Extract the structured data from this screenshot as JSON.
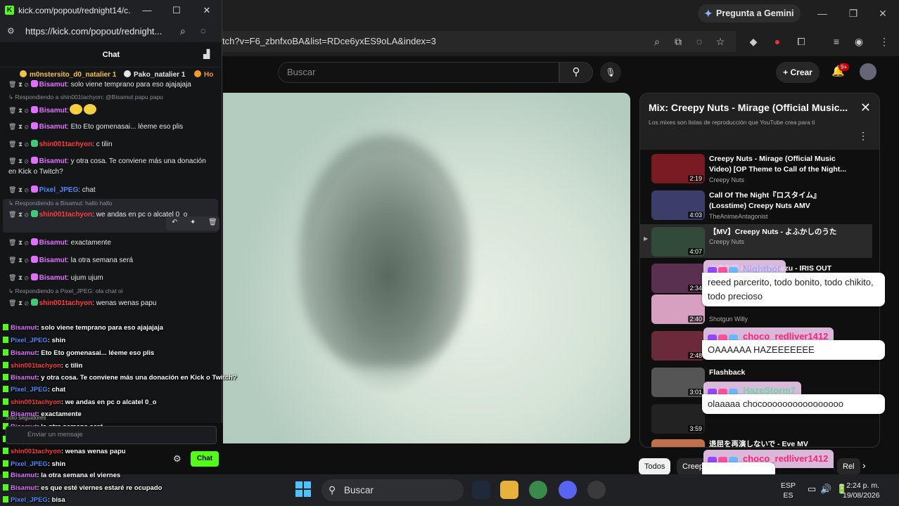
{
  "browser": {
    "gemini_label": "Pregunta a Gemini",
    "url": "tch?v=F6_zbnfxoBA&list=RDce6yxES9oLA&index=3"
  },
  "youtube": {
    "search_placeholder": "Buscar",
    "create_label": "Crear",
    "notif_badge": "9+",
    "playlist": {
      "title": "Mix: Creepy Nuts - Mirage (Official Music...",
      "subtitle": "Los mixes son listas de reproducción que YouTube crea para ti",
      "items": [
        {
          "title": "Creepy Nuts - Mirage (Official Music Video) [OP Theme to Call of the Night...",
          "channel": "Creepy Nuts",
          "duration": "2:19",
          "color": "#7a1a22"
        },
        {
          "title": "Call Of The Night『ロスタイム』(Losstime) Creepy Nuts AMV",
          "channel": "TheAnimeAntagonist",
          "duration": "4:03",
          "color": "#3c3d6b"
        },
        {
          "title": "【MV】Creepy Nuts - よふかしのうた",
          "channel": "Creepy Nuts",
          "duration": "4:07",
          "color": "#314a3a"
        },
        {
          "title": "米津玄師 Kenshi Yonezu - IRIS OUT",
          "channel": "",
          "duration": "2:34",
          "color": "#5a3050"
        },
        {
          "title": "",
          "channel": "Shotgun Willy",
          "duration": "2:40",
          "color": "#d8a0c0"
        },
        {
          "title": "",
          "channel": "",
          "duration": "2:48",
          "color": "#6a2a3a"
        },
        {
          "title": "Flashback",
          "channel": "",
          "duration": "3:01",
          "color": "#555"
        },
        {
          "title": "",
          "channel": "",
          "duration": "3:59",
          "color": "#222"
        },
        {
          "title": "退屈を再演しないで - Eve MV",
          "channel": "",
          "duration": "",
          "color": "#c0704a"
        }
      ]
    },
    "chips": [
      "Todos",
      "Creep",
      "Rel"
    ]
  },
  "overlay_right": [
    {
      "name": "Nightbot",
      "name_color": "#a5a7f5",
      "message": "reeed parcerito, todo bonito, todo chikito, todo precioso"
    },
    {
      "name": "choco_redliver1412",
      "name_color": "#ff2277",
      "message": "OAAAAAA HAZEEEEEEE"
    },
    {
      "name": "HazeStorm7",
      "name_color": "#67d7a4",
      "message": "olaaaaa chocoooooooooooooooo"
    },
    {
      "name": "choco_redliver1412",
      "name_color": "#ff2277",
      "message": ""
    }
  ],
  "taskbar": {
    "search": "Buscar",
    "lang_top": "ESP",
    "lang_bottom": "ES",
    "time": "2:24 p. m.",
    "date": "19/08/2026"
  },
  "kick": {
    "window_title": "kick.com/popout/rednight14/c...",
    "url": "https://kick.com/popout/rednight...",
    "chat_title": "Chat",
    "pinned": [
      {
        "name": "m0nstersito_d0_natalier",
        "count": "1",
        "color": "#f6c244"
      },
      {
        "name": "Pako_natalier",
        "count": "1",
        "color": "#e6e6e6"
      },
      {
        "name": "Ho",
        "count": "",
        "color": "#f39a2e"
      }
    ],
    "messages": [
      {
        "user": "Bisamut",
        "text": ": solo viene temprano para eso ajajajaja"
      },
      {
        "reply": "Respondiendo a shin001tachyon: @Bisamut papu papu"
      },
      {
        "user": "Bisamut",
        "text": ":"
      },
      {
        "user": "Bisamut",
        "text": ": Eto Eto gomenasai... léeme eso plis"
      },
      {
        "user": "shin001tachyon",
        "text": ": c tilin"
      },
      {
        "user": "Bisamut",
        "text": ": y otra cosa. Te conviene más una donación en Kick o Twitch?"
      },
      {
        "user": "Pixel_JPEG",
        "text": ": chat"
      },
      {
        "reply": "Respondiendo a Bisamut: hallo hallo"
      },
      {
        "user": "shin001tachyon",
        "text": ": we andas en pc o alcatel 0_o"
      },
      {
        "user": "Bisamut",
        "text": ": exactamente"
      },
      {
        "user": "Bisamut",
        "text": ": la otra semana será"
      },
      {
        "user": "Bisamut",
        "text": ": ujum ujum"
      },
      {
        "reply": "Respondiendo a Pixel_JPEG: ola chat oi"
      },
      {
        "user": "shin001tachyon",
        "text": ": wenas wenas papu"
      }
    ],
    "overlay": [
      {
        "user": "Bisamut",
        "text": ": solo viene temprano para eso ajajajaja"
      },
      {
        "user": "Pixel_JPEG",
        "text": ": shin"
      },
      {
        "user": "Bisamut",
        "text": ": Eto Eto gomenasai... léeme eso plis"
      },
      {
        "user": "shin001tachyon",
        "text": ": c tilin"
      },
      {
        "user": "Bisamut",
        "text": ": y otra cosa. Te conviene más una donación en Kick o Twitch?"
      },
      {
        "user": "Pixel_JPEG",
        "text": ": chat"
      },
      {
        "user": "shin001tachyon",
        "text": ": we andas en pc o alcatel 0_o"
      },
      {
        "user": "Bisamut",
        "text": ": exactamente"
      },
      {
        "user": "Bisamut",
        "text": ": la otra semana será"
      },
      {
        "user": "Bisamut",
        "text": ": ujum ujum"
      },
      {
        "user": "shin001tachyon",
        "text": ": wenas wenas papu"
      },
      {
        "user": "Pixel_JPEG",
        "text": ": shin"
      },
      {
        "user": "Bisamut",
        "text": ": la otra semana el viernes"
      },
      {
        "user": "Bisamut",
        "text": ": es que esté viernes estaré re ocupado"
      },
      {
        "user": "Pixel_JPEG",
        "text": ": bisa"
      }
    ],
    "followers_only": "Solo seguidores",
    "input_placeholder": "Enviar un mensaje",
    "chat_button": "Chat",
    "colors": {
      "Bisamut": "#e070ff",
      "shin001tachyon": "#ff3a3a",
      "Pixel_JPEG": "#4d8bff"
    }
  }
}
